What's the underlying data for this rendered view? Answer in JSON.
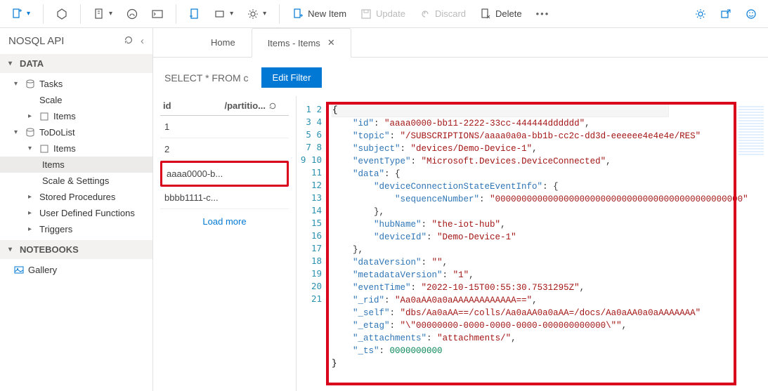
{
  "toolbar": {
    "newItem": "New Item",
    "update": "Update",
    "discard": "Discard",
    "delete": "Delete"
  },
  "sidebar": {
    "title": "NOSQL API",
    "sections": {
      "data": "DATA",
      "notebooks": "NOTEBOOKS"
    },
    "tree": {
      "tasks": "Tasks",
      "scale": "Scale",
      "items_under_tasks": "Items",
      "todolist": "ToDoList",
      "items": "Items",
      "items_selected": "Items",
      "scale_settings": "Scale & Settings",
      "stored_procs": "Stored Procedures",
      "udf": "User Defined Functions",
      "triggers": "Triggers",
      "gallery": "Gallery"
    }
  },
  "tabs": {
    "home": "Home",
    "items": "Items - Items"
  },
  "query": {
    "text": "SELECT * FROM c",
    "editFilter": "Edit Filter"
  },
  "itemsPane": {
    "headers": {
      "id": "id",
      "partition": "/partitio..."
    },
    "rows": [
      "1",
      "2",
      "aaaa0000-b...",
      "bbbb1111-c..."
    ],
    "loadMore": "Load more"
  },
  "editor": {
    "lines": 21,
    "json": {
      "id": "aaaa0000-bb11-2222-33cc-444444dddddd",
      "topic": "/SUBSCRIPTIONS/aaaa0a0a-bb1b-cc2c-dd3d-eeeeee4e4e4e/RES",
      "subject": "devices/Demo-Device-1",
      "eventType": "Microsoft.Devices.DeviceConnected",
      "data_label": "data",
      "deviceConnectionStateEventInfo": "deviceConnectionStateEventInfo",
      "sequenceNumber": "sequenceNumber",
      "sequenceNumber_val": "00000000000000000000000000000000000000000000000",
      "hubName": "hubName",
      "hubName_val": "the-iot-hub",
      "deviceId": "deviceId",
      "deviceId_val": "Demo-Device-1",
      "dataVersion": "dataVersion",
      "dataVersion_val": "",
      "metadataVersion": "metadataVersion",
      "metadataVersion_val": "1",
      "eventTime": "eventTime",
      "eventTime_val": "2022-10-15T00:55:30.7531295Z",
      "rid": "_rid",
      "rid_val": "Aa0aAA0a0aAAAAAAAAAAAA==",
      "self": "_self",
      "self_val": "dbs/Aa0aAA==/colls/Aa0aAA0a0aAA=/docs/Aa0aAA0a0aAAAAAAA",
      "etag": "_etag",
      "etag_val": "\\\"00000000-0000-0000-0000-000000000000\\\"",
      "attachments": "_attachments",
      "attachments_val": "attachments/",
      "ts": "_ts",
      "ts_val": "0000000000"
    }
  }
}
